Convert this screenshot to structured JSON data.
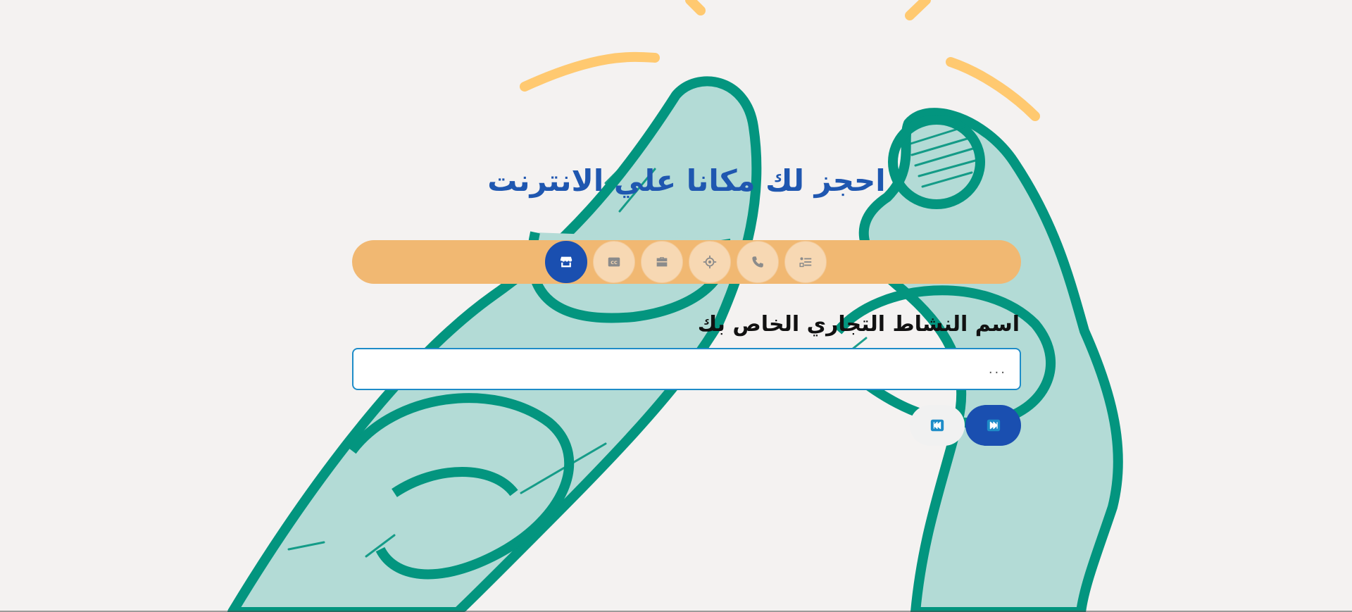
{
  "page": {
    "title": "احجز لك مكانا علي الانترنت"
  },
  "steps": [
    {
      "icon": "store-icon",
      "active": true
    },
    {
      "icon": "closed-captions-icon",
      "active": false
    },
    {
      "icon": "briefcase-icon",
      "active": false
    },
    {
      "icon": "location-target-icon",
      "active": false
    },
    {
      "icon": "phone-icon",
      "active": false
    },
    {
      "icon": "checklist-icon",
      "active": false
    }
  ],
  "form": {
    "label": "اسم النشاط التجاري الخاص بك",
    "input_value": "",
    "input_placeholder": "..."
  },
  "nav": {
    "prev_icon": "rewind-icon",
    "next_icon": "fast-forward-icon"
  },
  "colors": {
    "background": "#f4f2f1",
    "title": "#1f57b0",
    "stepper_bar": "#f1b872",
    "step_inactive": "#f7d8b3",
    "accent": "#1a4fb0",
    "input_border": "#1e8cc8",
    "illustration_dark": "#03957f",
    "illustration_light": "#b3dbd6",
    "illustration_yellow": "#ffc970"
  }
}
